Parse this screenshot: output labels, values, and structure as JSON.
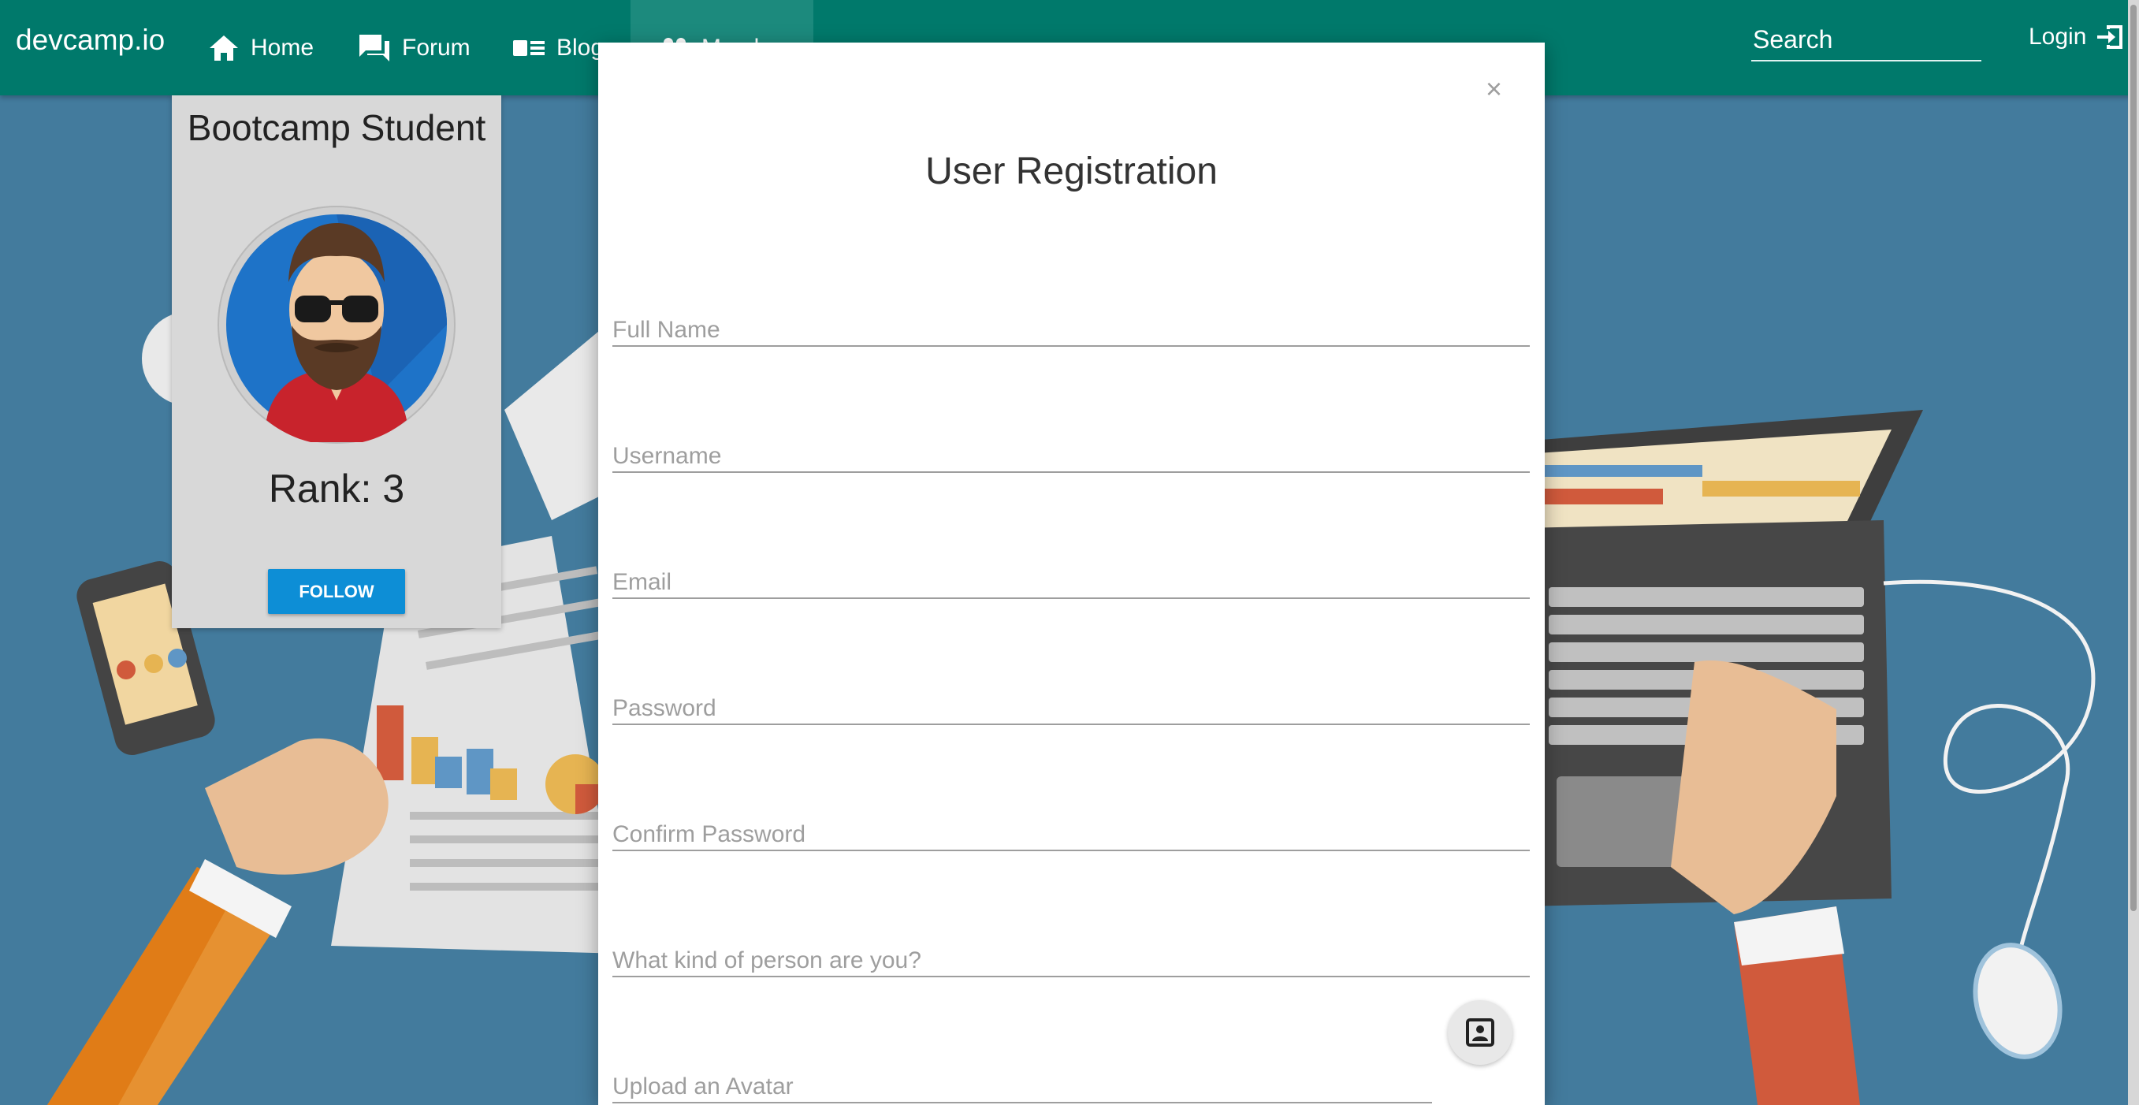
{
  "nav": {
    "brand": "devcamp.io",
    "items": [
      {
        "label": "Home",
        "icon": "home-icon"
      },
      {
        "label": "Forum",
        "icon": "forum-icon"
      },
      {
        "label": "Blogs",
        "icon": "blogs-icon"
      },
      {
        "label": "Members",
        "icon": "members-icon"
      }
    ],
    "search_placeholder": "Search",
    "login_label": "Login",
    "color": "#00796b"
  },
  "profile_card": {
    "title": "Bootcamp Student",
    "rank": "Rank: 3",
    "follow_label": "FOLLOW"
  },
  "modal": {
    "title": "User Registration",
    "close_label": "×",
    "fields": [
      {
        "placeholder": "Full Name"
      },
      {
        "placeholder": "Username"
      },
      {
        "placeholder": "Email"
      },
      {
        "placeholder": "Password"
      },
      {
        "placeholder": "Confirm Password"
      },
      {
        "placeholder": "What kind of person are you?"
      }
    ],
    "upload_placeholder": "Upload an Avatar"
  }
}
